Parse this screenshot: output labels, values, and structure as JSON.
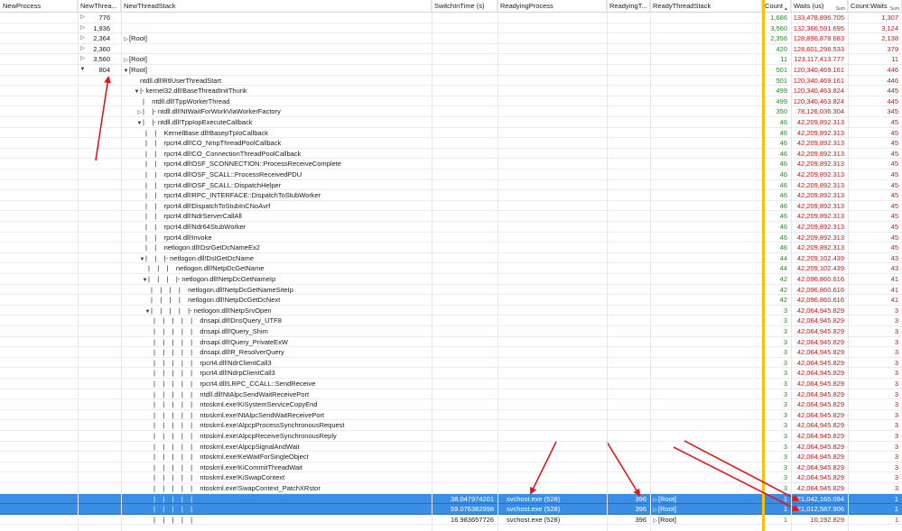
{
  "columns": [
    {
      "label": "NewProcess"
    },
    {
      "label": "NewThrea..."
    },
    {
      "label": "NewThreadStack"
    },
    {
      "label": "SwitchInTime (s)"
    },
    {
      "label": "ReadyingProcess"
    },
    {
      "label": "ReadyingT..."
    },
    {
      "label": "ReadyThreadStack"
    },
    {
      "label": "Count",
      "sub": "▲"
    },
    {
      "label": "Waits (us)",
      "sub": "Sum"
    },
    {
      "label": "Count:Waits",
      "sub": "Sum"
    }
  ],
  "rows": [
    {
      "tid": "776",
      "exp": "right",
      "depth": 0,
      "stack": "",
      "switchin": "",
      "rproc": "",
      "rtid": "",
      "rstack": "",
      "count": "1,686",
      "waits": "133,478,896.705",
      "cw": "1,307"
    },
    {
      "tid": "1,936",
      "exp": "right",
      "depth": 0,
      "stack": "",
      "switchin": "",
      "rproc": "",
      "rtid": "",
      "rstack": "",
      "count": "3,560",
      "waits": "132,366,591.695",
      "cw": "3,124"
    },
    {
      "tid": "2,364",
      "exp": "right",
      "depth": 0,
      "stack": "[Root]",
      "switchin": "",
      "rproc": "",
      "rtid": "",
      "rstack": "",
      "count": "2,356",
      "waits": "128,896,878.683",
      "cw": "2,138"
    },
    {
      "tid": "2,360",
      "exp": "right",
      "depth": 0,
      "stack": "",
      "switchin": "",
      "rproc": "",
      "rtid": "",
      "rstack": "",
      "count": "420",
      "waits": "128,601,298.533",
      "cw": "379"
    },
    {
      "tid": "3,560",
      "exp": "right",
      "depth": 0,
      "stack": "[Root]",
      "switchin": "",
      "rproc": "",
      "rtid": "",
      "rstack": "",
      "count": "11",
      "waits": "123,117,413.777",
      "cw": "11"
    },
    {
      "tid": "804",
      "exp": "down",
      "depth": 0,
      "stack": "[Root]",
      "switchin": "",
      "rproc": "",
      "rtid": "",
      "rstack": "",
      "count": "501",
      "waits": "120,340,469.161",
      "cw": "446"
    },
    {
      "tid": "",
      "exp": "",
      "depth": 1,
      "stack": "ntdll.dll!RtlUserThreadStart",
      "switchin": "",
      "rproc": "",
      "rtid": "",
      "rstack": "",
      "count": "501",
      "waits": "120,340,469.161",
      "cw": "446"
    },
    {
      "tid": "",
      "exp": "down",
      "depth": 1,
      "stack": "|- kernel32.dll!BaseThreadInitThunk",
      "switchin": "",
      "rproc": "",
      "rtid": "",
      "rstack": "",
      "count": "499",
      "waits": "120,340,463.824",
      "cw": "445"
    },
    {
      "tid": "",
      "exp": "",
      "depth": 2,
      "stack": "|    ntdll.dll!TppWorkerThread",
      "switchin": "",
      "rproc": "",
      "rtid": "",
      "rstack": "",
      "count": "499",
      "waits": "120,340,463.824",
      "cw": "445"
    },
    {
      "tid": "",
      "exp": "right",
      "depth": 2,
      "stack": "|    |- ntdll.dll!NtWaitForWorkViaWorkerFactory",
      "switchin": "",
      "rproc": "",
      "rtid": "",
      "rstack": "",
      "count": "350",
      "waits": "78,126,036.304",
      "cw": "345"
    },
    {
      "tid": "",
      "exp": "down",
      "depth": 2,
      "stack": "|    |- ntdll.dll!TppIopExecuteCallback",
      "switchin": "",
      "rproc": "",
      "rtid": "",
      "rstack": "",
      "count": "46",
      "waits": "42,209,892.313",
      "cw": "45"
    },
    {
      "tid": "",
      "exp": "",
      "depth": 3,
      "stack": "|    |    KernelBase.dll!BasepTpIoCallback",
      "switchin": "",
      "rproc": "",
      "rtid": "",
      "rstack": "",
      "count": "46",
      "waits": "42,209,892.313",
      "cw": "45"
    },
    {
      "tid": "",
      "exp": "",
      "depth": 3,
      "stack": "|    |    rpcrt4.dll!CO_NmpThreadPoolCallback",
      "switchin": "",
      "rproc": "",
      "rtid": "",
      "rstack": "",
      "count": "46",
      "waits": "42,209,892.313",
      "cw": "45"
    },
    {
      "tid": "",
      "exp": "",
      "depth": 3,
      "stack": "|    |    rpcrt4.dll!CO_ConnectionThreadPoolCallback",
      "switchin": "",
      "rproc": "",
      "rtid": "",
      "rstack": "",
      "count": "46",
      "waits": "42,209,892.313",
      "cw": "45"
    },
    {
      "tid": "",
      "exp": "",
      "depth": 3,
      "stack": "|    |    rpcrt4.dll!OSF_SCONNECTION::ProcessReceiveComplete",
      "switchin": "",
      "rproc": "",
      "rtid": "",
      "rstack": "",
      "count": "46",
      "waits": "42,209,892.313",
      "cw": "45"
    },
    {
      "tid": "",
      "exp": "",
      "depth": 3,
      "stack": "|    |    rpcrt4.dll!OSF_SCALL::ProcessReceivedPDU",
      "switchin": "",
      "rproc": "",
      "rtid": "",
      "rstack": "",
      "count": "46",
      "waits": "42,209,892.313",
      "cw": "45"
    },
    {
      "tid": "",
      "exp": "",
      "depth": 3,
      "stack": "|    |    rpcrt4.dll!OSF_SCALL::DispatchHelper",
      "switchin": "",
      "rproc": "",
      "rtid": "",
      "rstack": "",
      "count": "46",
      "waits": "42,209,892.313",
      "cw": "45"
    },
    {
      "tid": "",
      "exp": "",
      "depth": 3,
      "stack": "|    |    rpcrt4.dll!RPC_INTERFACE::DispatchToStubWorker",
      "switchin": "",
      "rproc": "",
      "rtid": "",
      "rstack": "",
      "count": "46",
      "waits": "42,209,892.313",
      "cw": "45"
    },
    {
      "tid": "",
      "exp": "",
      "depth": 3,
      "stack": "|    |    rpcrt4.dll!DispatchToStubInCNoAvrf",
      "switchin": "",
      "rproc": "",
      "rtid": "",
      "rstack": "",
      "count": "46",
      "waits": "42,209,892.313",
      "cw": "45"
    },
    {
      "tid": "",
      "exp": "",
      "depth": 3,
      "stack": "|    |    rpcrt4.dll!NdrServerCallAll",
      "switchin": "",
      "rproc": "",
      "rtid": "",
      "rstack": "",
      "count": "46",
      "waits": "42,209,892.313",
      "cw": "45"
    },
    {
      "tid": "",
      "exp": "",
      "depth": 3,
      "stack": "|    |    rpcrt4.dll!Ndr64StubWorker",
      "switchin": "",
      "rproc": "",
      "rtid": "",
      "rstack": "",
      "count": "46",
      "waits": "42,209,892.313",
      "cw": "45"
    },
    {
      "tid": "",
      "exp": "",
      "depth": 3,
      "stack": "|    |    rpcrt4.dll!Invoke",
      "switchin": "",
      "rproc": "",
      "rtid": "",
      "rstack": "",
      "count": "46",
      "waits": "42,209,892.313",
      "cw": "45"
    },
    {
      "tid": "",
      "exp": "",
      "depth": 3,
      "stack": "|    |    netlogon.dll!DsrGetDcNameEx2",
      "switchin": "",
      "rproc": "",
      "rtid": "",
      "rstack": "",
      "count": "46",
      "waits": "42,209,892.313",
      "cw": "45"
    },
    {
      "tid": "",
      "exp": "down",
      "depth": 3,
      "stack": "|    |    |- netlogon.dll!DsIGetDcName",
      "switchin": "",
      "rproc": "",
      "rtid": "",
      "rstack": "",
      "count": "44",
      "waits": "42,209,102.439",
      "cw": "43"
    },
    {
      "tid": "",
      "exp": "",
      "depth": 4,
      "stack": "|    |    |    netlogon.dll!NetpDcGetName",
      "switchin": "",
      "rproc": "",
      "rtid": "",
      "rstack": "",
      "count": "44",
      "waits": "42,209,102.439",
      "cw": "43"
    },
    {
      "tid": "",
      "exp": "down",
      "depth": 4,
      "stack": "|    |    |    |- netlogon.dll!NetpDcGetNameIp",
      "switchin": "",
      "rproc": "",
      "rtid": "",
      "rstack": "",
      "count": "42",
      "waits": "42,096,860.616",
      "cw": "41"
    },
    {
      "tid": "",
      "exp": "",
      "depth": 5,
      "stack": "|    |    |    |    netlogon.dll!NetpDcGetNameSiteIp",
      "switchin": "",
      "rproc": "",
      "rtid": "",
      "rstack": "",
      "count": "42",
      "waits": "42,096,860.616",
      "cw": "41"
    },
    {
      "tid": "",
      "exp": "",
      "depth": 5,
      "stack": "|    |    |    |    netlogon.dll!NetpDcGetDcNext",
      "switchin": "",
      "rproc": "",
      "rtid": "",
      "rstack": "",
      "count": "42",
      "waits": "42,096,860.616",
      "cw": "41"
    },
    {
      "tid": "",
      "exp": "down",
      "depth": 5,
      "stack": "|    |    |    |    |- netlogon.dll!NetpSrvOpen",
      "switchin": "",
      "rproc": "",
      "rtid": "",
      "rstack": "",
      "count": "3",
      "waits": "42,064,945.829",
      "cw": "3"
    },
    {
      "tid": "",
      "exp": "",
      "depth": 6,
      "stack": "|    |    |    |    |    dnsapi.dll!DnsQuery_UTF8",
      "switchin": "",
      "rproc": "",
      "rtid": "",
      "rstack": "",
      "count": "3",
      "waits": "42,064,945.829",
      "cw": "3"
    },
    {
      "tid": "",
      "exp": "",
      "depth": 6,
      "stack": "|    |    |    |    |    dnsapi.dll!Query_Shim",
      "switchin": "",
      "rproc": "",
      "rtid": "",
      "rstack": "",
      "count": "3",
      "waits": "42,064,945.829",
      "cw": "3"
    },
    {
      "tid": "",
      "exp": "",
      "depth": 6,
      "stack": "|    |    |    |    |    dnsapi.dll!Query_PrivateExW",
      "switchin": "",
      "rproc": "",
      "rtid": "",
      "rstack": "",
      "count": "3",
      "waits": "42,064,945.829",
      "cw": "3"
    },
    {
      "tid": "",
      "exp": "",
      "depth": 6,
      "stack": "|    |    |    |    |    dnsapi.dll!R_ResolverQuery",
      "switchin": "",
      "rproc": "",
      "rtid": "",
      "rstack": "",
      "count": "3",
      "waits": "42,064,945.829",
      "cw": "3"
    },
    {
      "tid": "",
      "exp": "",
      "depth": 6,
      "stack": "|    |    |    |    |    rpcrt4.dll!NdrClientCall3",
      "switchin": "",
      "rproc": "",
      "rtid": "",
      "rstack": "",
      "count": "3",
      "waits": "42,064,945.829",
      "cw": "3"
    },
    {
      "tid": "",
      "exp": "",
      "depth": 6,
      "stack": "|    |    |    |    |    rpcrt4.dll!NdrpClientCall3",
      "switchin": "",
      "rproc": "",
      "rtid": "",
      "rstack": "",
      "count": "3",
      "waits": "42,064,945.829",
      "cw": "3"
    },
    {
      "tid": "",
      "exp": "",
      "depth": 6,
      "stack": "|    |    |    |    |    rpcrt4.dll!LRPC_CCALL::SendReceive",
      "switchin": "",
      "rproc": "",
      "rtid": "",
      "rstack": "",
      "count": "3",
      "waits": "42,064,945.829",
      "cw": "3"
    },
    {
      "tid": "",
      "exp": "",
      "depth": 6,
      "stack": "|    |    |    |    |    ntdll.dll!NtAlpcSendWaitReceivePort",
      "switchin": "",
      "rproc": "",
      "rtid": "",
      "rstack": "",
      "count": "3",
      "waits": "42,064,945.829",
      "cw": "3"
    },
    {
      "tid": "",
      "exp": "",
      "depth": 6,
      "stack": "|    |    |    |    |    ntoskrnl.exe!KiSystemServiceCopyEnd",
      "switchin": "",
      "rproc": "",
      "rtid": "",
      "rstack": "",
      "count": "3",
      "waits": "42,064,945.829",
      "cw": "3"
    },
    {
      "tid": "",
      "exp": "",
      "depth": 6,
      "stack": "|    |    |    |    |    ntoskrnl.exe!NtAlpcSendWaitReceivePort",
      "switchin": "",
      "rproc": "",
      "rtid": "",
      "rstack": "",
      "count": "3",
      "waits": "42,064,945.829",
      "cw": "3"
    },
    {
      "tid": "",
      "exp": "",
      "depth": 6,
      "stack": "|    |    |    |    |    ntoskrnl.exe!AlpcpProcessSynchronousRequest",
      "switchin": "",
      "rproc": "",
      "rtid": "",
      "rstack": "",
      "count": "3",
      "waits": "42,064,945.829",
      "cw": "3"
    },
    {
      "tid": "",
      "exp": "",
      "depth": 6,
      "stack": "|    |    |    |    |    ntoskrnl.exe!AlpcpReceiveSynchronousReply",
      "switchin": "",
      "rproc": "",
      "rtid": "",
      "rstack": "",
      "count": "3",
      "waits": "42,064,945.829",
      "cw": "3"
    },
    {
      "tid": "",
      "exp": "",
      "depth": 6,
      "stack": "|    |    |    |    |    ntoskrnl.exe!AlpcpSignalAndWait",
      "switchin": "",
      "rproc": "",
      "rtid": "",
      "rstack": "",
      "count": "3",
      "waits": "42,064,945.829",
      "cw": "3"
    },
    {
      "tid": "",
      "exp": "",
      "depth": 6,
      "stack": "|    |    |    |    |    ntoskrnl.exe!KeWaitForSingleObject",
      "switchin": "",
      "rproc": "",
      "rtid": "",
      "rstack": "",
      "count": "3",
      "waits": "42,064,945.829",
      "cw": "3"
    },
    {
      "tid": "",
      "exp": "",
      "depth": 6,
      "stack": "|    |    |    |    |    ntoskrnl.exe!KiCommitThreadWait",
      "switchin": "",
      "rproc": "",
      "rtid": "",
      "rstack": "",
      "count": "3",
      "waits": "42,064,945.829",
      "cw": "3"
    },
    {
      "tid": "",
      "exp": "",
      "depth": 6,
      "stack": "|    |    |    |    |    ntoskrnl.exe!KiSwapContext",
      "switchin": "",
      "rproc": "",
      "rtid": "",
      "rstack": "",
      "count": "3",
      "waits": "42,064,945.829",
      "cw": "3"
    },
    {
      "tid": "",
      "exp": "",
      "depth": 6,
      "stack": "|    |    |    |    |    ntoskrnl.exe!SwapContext_PatchXRstor",
      "switchin": "",
      "rproc": "",
      "rtid": "",
      "rstack": "",
      "count": "3",
      "waits": "42,064,945.829",
      "cw": "3"
    },
    {
      "tid": "",
      "exp": "",
      "depth": 6,
      "stack": "|    |    |    |    |",
      "switchin": "38.047974201",
      "rproc": "svchost.exe (528)",
      "rtid": "396",
      "rstack": "[Root]",
      "count": "1",
      "waits": "21,042,165.094",
      "cw": "1",
      "sel": true
    },
    {
      "tid": "",
      "exp": "",
      "depth": 6,
      "stack": "|    |    |    |    |",
      "switchin": "59.076382998",
      "rproc": "svchost.exe (528)",
      "rtid": "396",
      "rstack": "[Root]",
      "count": "1",
      "waits": "21,012,587.906",
      "cw": "1",
      "sel": true
    },
    {
      "tid": "",
      "exp": "",
      "depth": 6,
      "stack": "|    |    |    |    |",
      "switchin": "16.983657726",
      "rproc": "svchost.exe (528)",
      "rtid": "396",
      "rstack": "[Root]",
      "count": "1",
      "waits": "10,192.829",
      "cw": "1"
    }
  ],
  "colors": {
    "selection": "#3a8ee6",
    "accent": "#f4c20d",
    "count": "#2a8a2a",
    "waits": "#c01818",
    "arrow": "#e0181e"
  }
}
